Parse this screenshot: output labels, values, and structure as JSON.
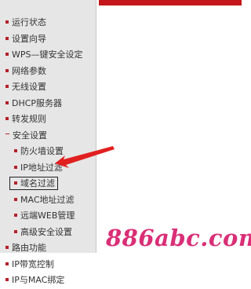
{
  "menu": [
    {
      "label": "运行状态",
      "level": 1
    },
    {
      "label": "设置向导",
      "level": 1
    },
    {
      "label": "WPS—键安全设定",
      "level": 1
    },
    {
      "label": "网络参数",
      "level": 1
    },
    {
      "label": "无线设置",
      "level": 1
    },
    {
      "label": "DHCP服务器",
      "level": 1
    },
    {
      "label": "转发规则",
      "level": 1
    },
    {
      "label": "安全设置",
      "level": 1,
      "expanded": true
    },
    {
      "label": "防火墙设置",
      "level": 2
    },
    {
      "label": "IP地址过滤",
      "level": 2
    },
    {
      "label": "域名过滤",
      "level": 2,
      "selected": true
    },
    {
      "label": "MAC地址过滤",
      "level": 2
    },
    {
      "label": "远端WEB管理",
      "level": 2
    },
    {
      "label": "高级安全设置",
      "level": 2
    },
    {
      "label": "路由功能",
      "level": 1
    },
    {
      "label": "IP带宽控制",
      "level": 1
    },
    {
      "label": "IP与MAC绑定",
      "level": 1
    }
  ],
  "watermark": "886abc.com",
  "colors": {
    "accent_red": "#c4171b",
    "bullet": "#b5202a",
    "arrow": "#e0201f",
    "watermark": "#d92f77"
  }
}
